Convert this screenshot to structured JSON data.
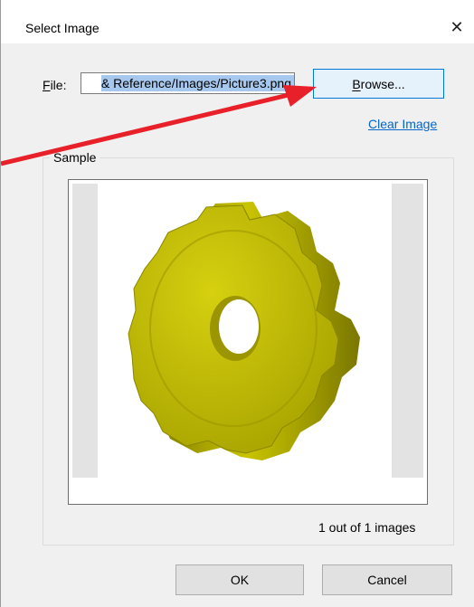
{
  "dialog": {
    "title": "Select Image",
    "close_glyph": "✕"
  },
  "file": {
    "label_underlined": "F",
    "label_rest": "ile:",
    "value": "& Reference/Images/Picture3.png",
    "browse_underlined": "B",
    "browse_rest": "rowse..."
  },
  "clear_link": "Clear Image",
  "sample": {
    "label": "Sample",
    "image_icon": "gear-part-image",
    "count_text": "1 out of 1 images"
  },
  "buttons": {
    "ok": "OK",
    "cancel": "Cancel"
  },
  "colors": {
    "arrow": "#e8202a",
    "gear_face": "#c8c300",
    "gear_side": "#8f8c00",
    "link": "#0066cc"
  }
}
